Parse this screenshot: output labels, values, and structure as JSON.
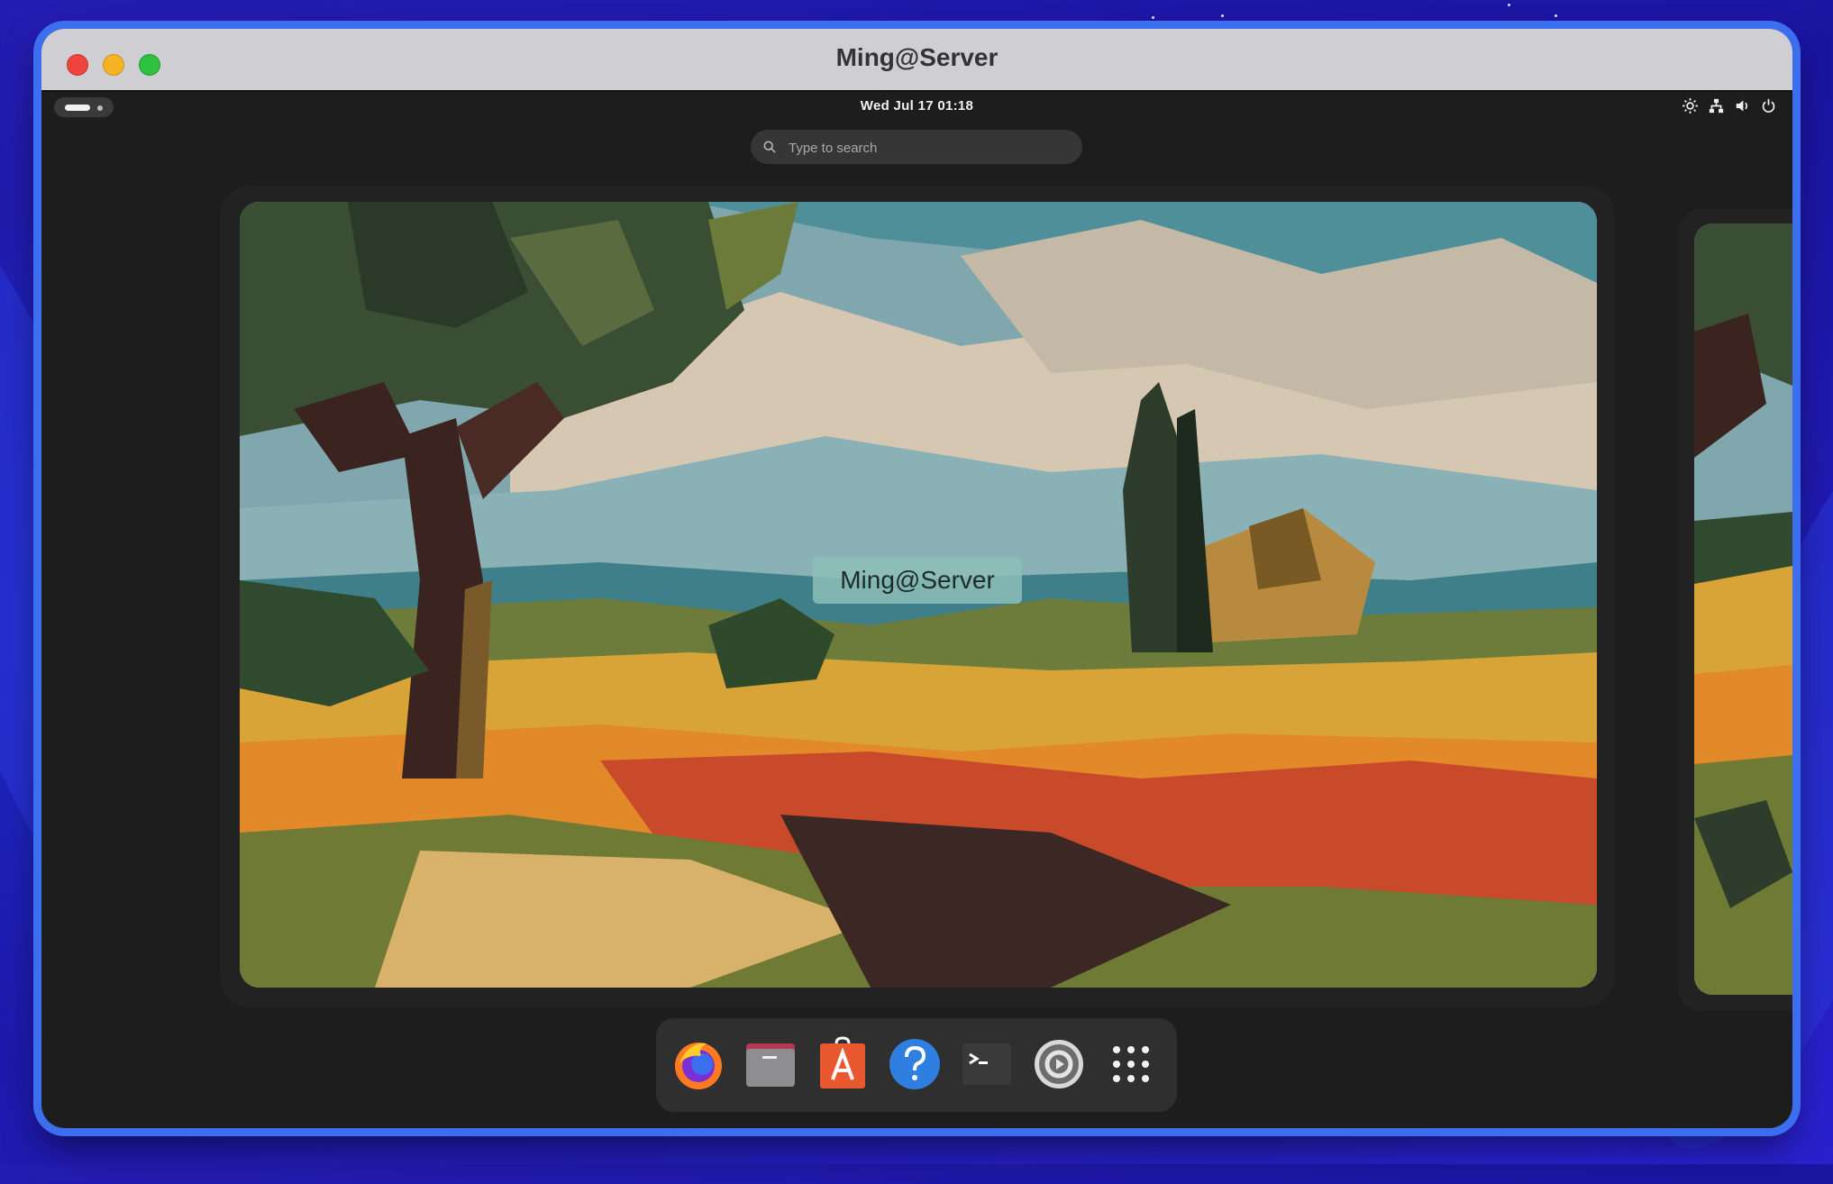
{
  "window": {
    "title": "Ming@Server"
  },
  "topbar": {
    "clock": "Wed Jul 17  01:18"
  },
  "search": {
    "placeholder": "Type to search"
  },
  "workspace": {
    "label": "Ming@Server"
  },
  "tray": {
    "icons": [
      "brightness-icon",
      "network-icon",
      "volume-icon",
      "power-icon"
    ]
  },
  "dock": {
    "apps": [
      "firefox-icon",
      "files-icon",
      "app-store-icon",
      "help-icon",
      "terminal-icon",
      "settings-icon",
      "app-grid-icon"
    ]
  },
  "colors": {
    "desktop_bg": "#241cb0",
    "window_border": "#3b6ff0",
    "titlebar": "#cfcfd3",
    "shell_bg": "#1d1d1d",
    "dock_bg": "#2f2f2f"
  }
}
